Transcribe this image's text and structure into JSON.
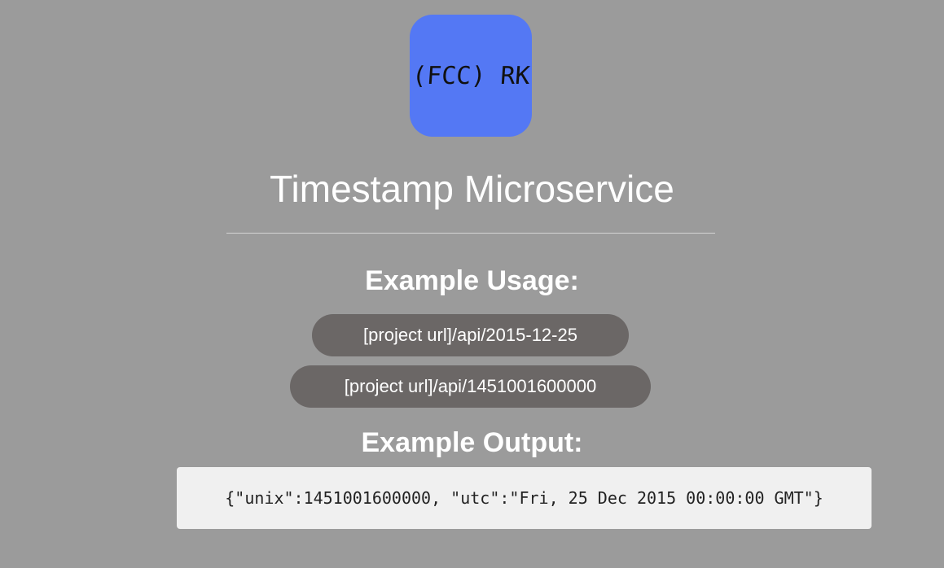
{
  "logo": {
    "text": "(FCC) RK",
    "color": "#5478f4"
  },
  "page": {
    "title": "Timestamp Microservice",
    "background": "#9b9b9b"
  },
  "usage": {
    "heading": "Example Usage:",
    "examples": [
      "[project url]/api/2015-12-25",
      "[project url]/api/1451001600000"
    ],
    "pill_color": "#6b6766"
  },
  "output": {
    "heading": "Example Output:",
    "code": "{\"unix\":1451001600000, \"utc\":\"Fri, 25 Dec 2015 00:00:00 GMT\"}"
  }
}
